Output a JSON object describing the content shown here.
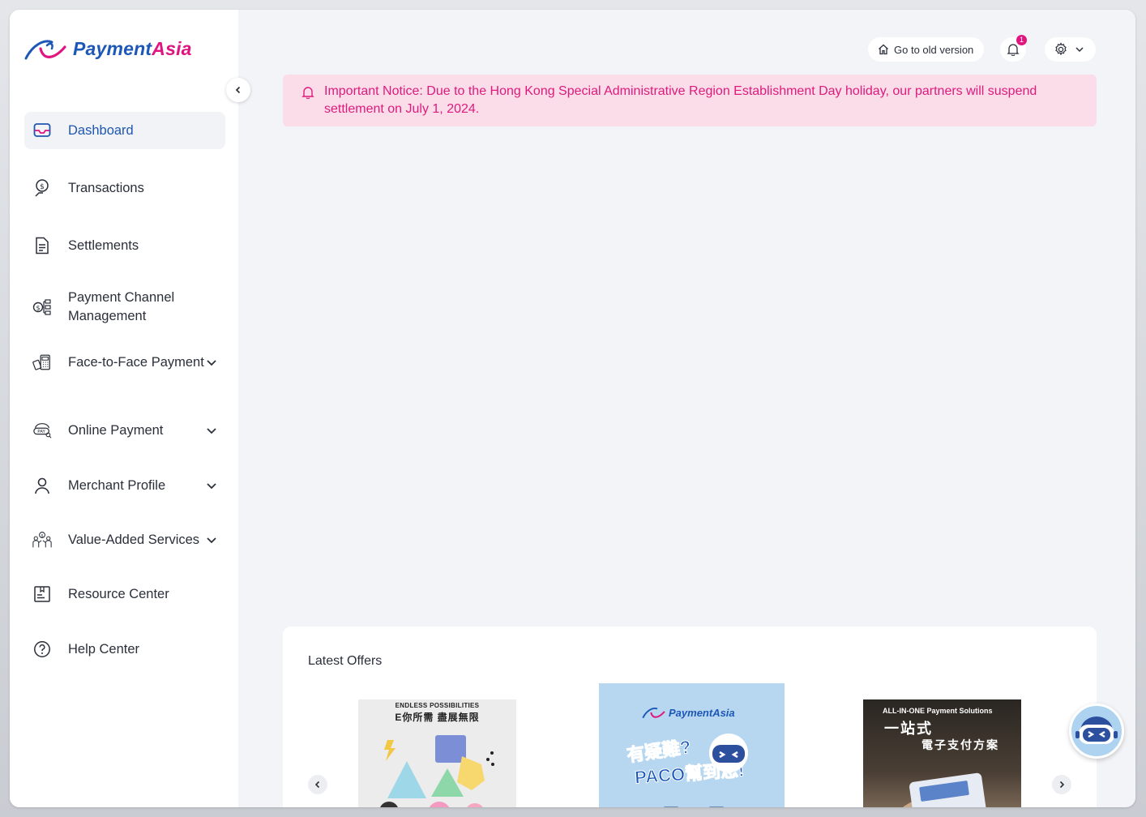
{
  "brand": {
    "name_part1": "Payment",
    "name_part2": "Asia",
    "primary": "#1d58b8",
    "accent": "#e0157f"
  },
  "sidebar": {
    "items": [
      {
        "label": "Dashboard",
        "icon": "inbox-icon",
        "active": true
      },
      {
        "label": "Transactions",
        "icon": "money-hand-icon"
      },
      {
        "label": "Settlements",
        "icon": "document-icon"
      },
      {
        "label": "Payment Channel Management",
        "icon": "channel-network-icon"
      },
      {
        "label": "Face-to-Face Payment",
        "icon": "pos-terminal-icon",
        "expandable": true
      },
      {
        "label": "Online Payment",
        "icon": "online-pay-icon",
        "expandable": true
      },
      {
        "label": "Merchant Profile",
        "icon": "user-icon",
        "expandable": true
      },
      {
        "label": "Value-Added Services",
        "icon": "people-coin-icon",
        "expandable": true
      },
      {
        "label": "Resource Center",
        "icon": "bookmark-doc-icon"
      },
      {
        "label": "Help Center",
        "icon": "help-circle-icon"
      }
    ]
  },
  "header": {
    "old_version_label": "Go to old version",
    "notification_count": "1"
  },
  "notice": {
    "text": "Important Notice: Due to the Hong Kong Special Administrative Region Establishment Day holiday, our partners will suspend settlement on July 1, 2024."
  },
  "offers": {
    "title": "Latest Offers",
    "cards": [
      {
        "line1": "ENDLESS POSSIBILITIES",
        "line2": "E你所需 盡展無限"
      },
      {
        "brand": "PaymentAsia",
        "line1": "有疑難?",
        "line2": "PACO幫到您!"
      },
      {
        "line1": "ALL-IN-ONE Payment Solutions",
        "line2": "一站式",
        "line3": "電子支付方案"
      }
    ]
  }
}
